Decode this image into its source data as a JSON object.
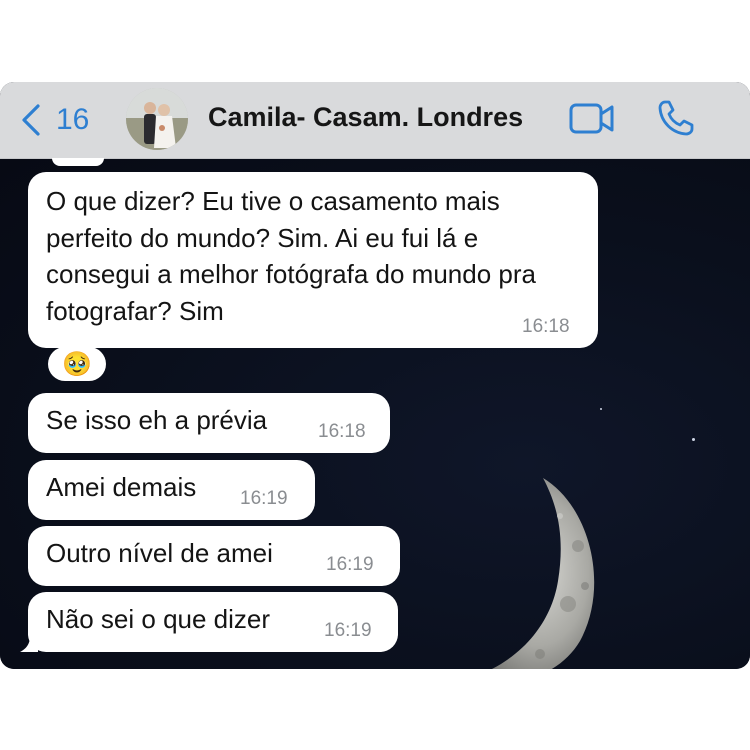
{
  "header": {
    "back_count": "16",
    "contact_name": "Camila- Casam. Londres",
    "icons": {
      "back": "chevron-left-icon",
      "video": "video-camera-icon",
      "phone": "phone-icon"
    },
    "accent_color": "#2e7fd1"
  },
  "messages": [
    {
      "text": "O que dizer? Eu tive o casamento mais perfeito do mundo? Sim. Ai eu fui lá e consegui a melhor fotógrafa do mundo pra fotografar? Sim",
      "time": "16:18",
      "reaction": "🥹"
    },
    {
      "text": "Se isso eh a prévia",
      "time": "16:18"
    },
    {
      "text": "Amei demais",
      "time": "16:19"
    },
    {
      "text": "Outro nível de amei",
      "time": "16:19"
    },
    {
      "text": "Não sei o que dizer",
      "time": "16:19"
    }
  ],
  "wallpaper": "crescent-moon-night-sky"
}
